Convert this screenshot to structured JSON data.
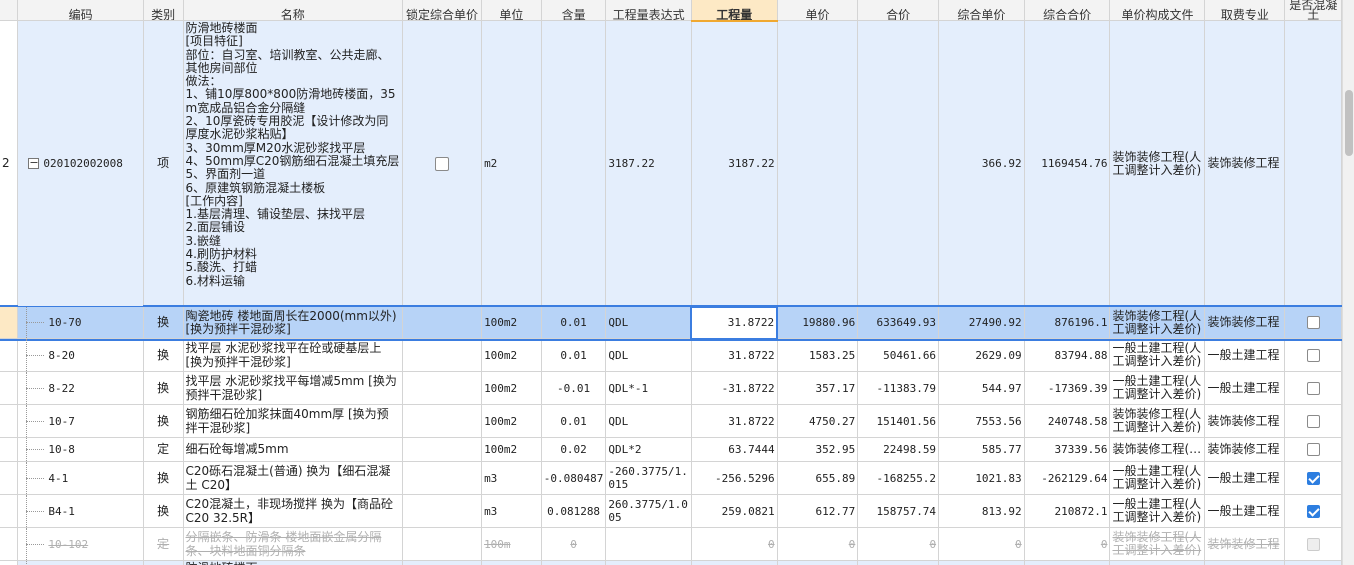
{
  "headers": {
    "code": "编码",
    "type": "类别",
    "name": "名称",
    "lock_price": "锁定综合单价",
    "unit": "单位",
    "content": "含量",
    "expr": "工程量表达式",
    "qty": "工程量",
    "unit_price": "单价",
    "total_price": "合价",
    "comp_unit_price": "综合单价",
    "comp_total": "综合合价",
    "price_file": "单价构成文件",
    "fee_major": "取费专业",
    "concrete": "是否混凝土"
  },
  "main_row": {
    "index": "2",
    "expander": "−",
    "code": "020102002008",
    "type": "项",
    "name_lines": [
      "防滑地砖楼面",
      "[项目特征]",
      "部位：自习室、培训教室、公共走廊、其他房间部位",
      "做法：",
      "1、铺10厚800*800防滑地砖楼面，35m宽成品铝合金分隔缝",
      "2、10厚瓷砖专用胶泥【设计修改为同厚度水泥砂浆粘贴】",
      "3、30mm厚M20水泥砂浆找平层",
      "4、50mm厚C20钢筋细石混凝土填充层",
      "5、界面剂一道",
      "6、原建筑钢筋混凝土楼板",
      "[工作内容]",
      "1.基层清理、铺设垫层、抹找平层",
      "2.面层铺设",
      "3.嵌缝",
      "4.刷防护材料",
      "5.酸洗、打蜡",
      "6.材料运输"
    ],
    "unit": "m2",
    "expr": "3187.22",
    "qty": "3187.22",
    "unit_price": "",
    "total_price": "",
    "comp_unit_price": "366.92",
    "comp_total": "1169454.76",
    "price_file": "装饰装修工程(人工调整计入差价)",
    "fee_major": "装饰装修工程"
  },
  "sub_rows": [
    {
      "code": "10-70",
      "type": "换",
      "name": "陶瓷地砖 楼地面周长在2000(mm以外) [换为预拌干混砂浆]",
      "unit": "100m2",
      "content": "0.01",
      "expr": "QDL",
      "qty": "31.8722",
      "unit_price": "19880.96",
      "total_price": "633649.93",
      "comp_unit_price": "27490.92",
      "comp_total": "876196.1",
      "price_file": "装饰装修工程(人工调整计入差价)",
      "fee_major": "装饰装修工程",
      "concrete": false,
      "selected": true
    },
    {
      "code": "8-20",
      "type": "换",
      "name": "找平层 水泥砂浆找平在砼或硬基层上 [换为预拌干混砂浆]",
      "unit": "100m2",
      "content": "0.01",
      "expr": "QDL",
      "qty": "31.8722",
      "unit_price": "1583.25",
      "total_price": "50461.66",
      "comp_unit_price": "2629.09",
      "comp_total": "83794.88",
      "price_file": "一般土建工程(人工调整计入差价)",
      "fee_major": "一般土建工程",
      "concrete": false
    },
    {
      "code": "8-22",
      "type": "换",
      "name": "找平层 水泥砂浆找平每增减5mm [换为预拌干混砂浆]",
      "unit": "100m2",
      "content": "-0.01",
      "expr": "QDL*-1",
      "qty": "-31.8722",
      "unit_price": "357.17",
      "total_price": "-11383.79",
      "comp_unit_price": "544.97",
      "comp_total": "-17369.39",
      "price_file": "一般土建工程(人工调整计入差价)",
      "fee_major": "一般土建工程",
      "concrete": false
    },
    {
      "code": "10-7",
      "type": "换",
      "name": "钢筋细石砼加浆抹面40mm厚 [换为预拌干混砂浆]",
      "unit": "100m2",
      "content": "0.01",
      "expr": "QDL",
      "qty": "31.8722",
      "unit_price": "4750.27",
      "total_price": "151401.56",
      "comp_unit_price": "7553.56",
      "comp_total": "240748.58",
      "price_file": "装饰装修工程(人工调整计入差价)",
      "fee_major": "装饰装修工程",
      "concrete": false
    },
    {
      "code": "10-8",
      "type": "定",
      "name": "细石砼每增减5mm",
      "unit": "100m2",
      "content": "0.02",
      "expr": "QDL*2",
      "qty": "63.7444",
      "unit_price": "352.95",
      "total_price": "22498.59",
      "comp_unit_price": "585.77",
      "comp_total": "37339.56",
      "price_file": "装饰装修工程(…",
      "fee_major": "装饰装修工程",
      "concrete": false
    },
    {
      "code": "4-1",
      "type": "换",
      "name": "C20砾石混凝土(普通) 换为【细石混凝土 C20】",
      "unit": "m3",
      "content": "-0.080487",
      "expr": "-260.3775/1.015",
      "qty": "-256.5296",
      "unit_price": "655.89",
      "total_price": "-168255.2",
      "comp_unit_price": "1021.83",
      "comp_total": "-262129.64",
      "price_file": "一般土建工程(人工调整计入差价)",
      "fee_major": "一般土建工程",
      "concrete": true
    },
    {
      "code": "B4-1",
      "type": "换",
      "name": "C20混凝土，非现场搅拌 换为【商品砼 C20 32.5R】",
      "unit": "m3",
      "content": "0.081288",
      "expr": "260.3775/1.005",
      "qty": "259.0821",
      "unit_price": "612.77",
      "total_price": "158757.74",
      "comp_unit_price": "813.92",
      "comp_total": "210872.1",
      "price_file": "一般土建工程(人工调整计入差价)",
      "fee_major": "一般土建工程",
      "concrete": true
    },
    {
      "code": "10-102",
      "type": "定",
      "name": "分隔嵌条、防滑条 楼地面嵌金属分隔条、块料地面铜分隔条",
      "unit": "100m",
      "content": "0",
      "expr": "",
      "qty": "0",
      "unit_price": "0",
      "total_price": "0",
      "comp_unit_price": "0",
      "comp_total": "0",
      "price_file": "装饰装修工程(人工调整计入差价)",
      "fee_major": "装饰装修工程",
      "concrete": false,
      "disabled": true
    }
  ],
  "next_row": {
    "name": "防滑地砖楼面"
  },
  "colors": {
    "main_bg": "#e4eefc",
    "selected_bg": "#b7d3f7",
    "header_highlight": "#fde9c5",
    "checkbox_on": "#2d7ee0"
  }
}
